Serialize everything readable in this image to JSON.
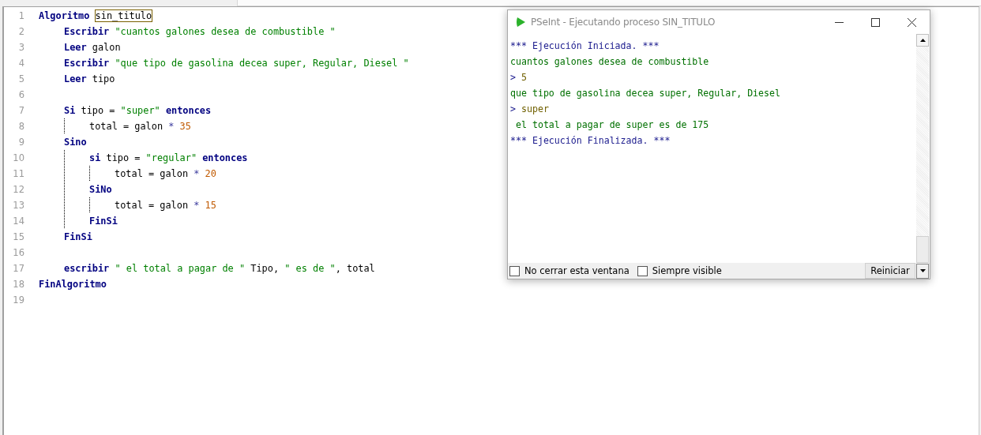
{
  "editor": {
    "lines": [
      {
        "number": "1",
        "tokens": [
          {
            "kind": "kw",
            "text": "Algoritmo "
          },
          {
            "kind": "id",
            "text": "sin_titulo",
            "boxed": true
          }
        ],
        "children": [
          {
            "number": "2",
            "tokens": [
              {
                "kind": "kw",
                "text": "Escribir"
              },
              {
                "kind": "str",
                "text": " \"cuantos galones desea de combustible \""
              }
            ]
          },
          {
            "number": "3",
            "tokens": [
              {
                "kind": "kw",
                "text": "Leer"
              },
              {
                "kind": "id",
                "text": " galon"
              }
            ]
          },
          {
            "number": "4",
            "tokens": [
              {
                "kind": "kw",
                "text": "Escribir"
              },
              {
                "kind": "str",
                "text": " \"que tipo de gasolina decea super, Regular, Diesel \""
              }
            ]
          },
          {
            "number": "5",
            "tokens": [
              {
                "kind": "kw",
                "text": "Leer"
              },
              {
                "kind": "id",
                "text": " tipo"
              }
            ]
          },
          {
            "number": "6"
          },
          {
            "number": "7",
            "tokens": [
              {
                "kind": "kw",
                "text": "Si"
              },
              {
                "kind": "id",
                "text": " tipo = "
              },
              {
                "kind": "str",
                "text": "\"super\""
              },
              {
                "kind": "kw",
                "text": " entonces"
              }
            ],
            "children": [
              {
                "number": "8",
                "tokens": [
                  {
                    "kind": "id",
                    "text": "total = galon "
                  },
                  {
                    "kind": "op",
                    "text": "*"
                  },
                  {
                    "kind": "num",
                    "text": " 35"
                  }
                ]
              }
            ]
          },
          {
            "number": "9",
            "tokens": [
              {
                "kind": "kw",
                "text": "Sino"
              }
            ],
            "children": [
              {
                "number": "10",
                "tokens": [
                  {
                    "kind": "kw",
                    "text": "si"
                  },
                  {
                    "kind": "id",
                    "text": " tipo = "
                  },
                  {
                    "kind": "str",
                    "text": "\"regular\""
                  },
                  {
                    "kind": "kw",
                    "text": " entonces"
                  }
                ],
                "children": [
                  {
                    "number": "11",
                    "tokens": [
                      {
                        "kind": "id",
                        "text": "total = galon "
                      },
                      {
                        "kind": "op",
                        "text": "*"
                      },
                      {
                        "kind": "num",
                        "text": " 20"
                      }
                    ]
                  }
                ]
              },
              {
                "number": "12",
                "tokens": [
                  {
                    "kind": "kw",
                    "text": "SiNo"
                  }
                ],
                "children": [
                  {
                    "number": "13",
                    "tokens": [
                      {
                        "kind": "id",
                        "text": "total = galon "
                      },
                      {
                        "kind": "op",
                        "text": "*"
                      },
                      {
                        "kind": "num",
                        "text": " 15"
                      }
                    ]
                  }
                ]
              },
              {
                "number": "14",
                "tokens": [
                  {
                    "kind": "kw",
                    "text": "FinSi"
                  }
                ]
              }
            ]
          },
          {
            "number": "15",
            "tokens": [
              {
                "kind": "kw",
                "text": "FinSi"
              }
            ]
          },
          {
            "number": "16"
          },
          {
            "number": "17",
            "tokens": [
              {
                "kind": "kw",
                "text": "escribir"
              },
              {
                "kind": "str",
                "text": " \" el total a pagar de \""
              },
              {
                "kind": "id",
                "text": " Tipo, "
              },
              {
                "kind": "str",
                "text": "\" es de \""
              },
              {
                "kind": "id",
                "text": ", total"
              }
            ]
          }
        ]
      },
      {
        "number": "18",
        "tokens": [
          {
            "kind": "kw",
            "text": "FinAlgoritmo"
          }
        ]
      },
      {
        "number": "19"
      }
    ]
  },
  "console": {
    "title": "PSeInt - Ejecutando proceso SIN_TITULO",
    "lines": [
      {
        "kind": "system",
        "text": "*** Ejecución Iniciada. ***"
      },
      {
        "kind": "output",
        "text": "cuantos galones desea de combustible"
      },
      {
        "kind": "input",
        "prompt": ">",
        "text": "5"
      },
      {
        "kind": "output",
        "text": "que tipo de gasolina decea super, Regular, Diesel"
      },
      {
        "kind": "input",
        "prompt": ">",
        "text": "super"
      },
      {
        "kind": "output",
        "text": " el total a pagar de super es de 175"
      },
      {
        "kind": "system",
        "text": "*** Ejecución Finalizada. ***"
      }
    ],
    "options": [
      {
        "label": "No cerrar esta ventana",
        "checked": false
      },
      {
        "label": "Siempre visible",
        "checked": false
      }
    ],
    "button": "Reiniciar"
  }
}
